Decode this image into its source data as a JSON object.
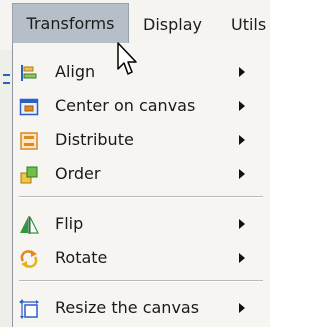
{
  "menubar": {
    "items": [
      {
        "label": "Transforms"
      },
      {
        "label": "Display"
      },
      {
        "label": "Utils"
      }
    ]
  },
  "menu": {
    "items": [
      {
        "label": "Align",
        "icon": "align-icon",
        "submenu": true
      },
      {
        "label": "Center on canvas",
        "icon": "center-on-canvas-icon",
        "submenu": true
      },
      {
        "label": "Distribute",
        "icon": "distribute-icon",
        "submenu": true
      },
      {
        "label": "Order",
        "icon": "order-icon",
        "submenu": true
      },
      {
        "label": "Flip",
        "icon": "flip-icon",
        "submenu": true
      },
      {
        "label": "Rotate",
        "icon": "rotate-icon",
        "submenu": true
      },
      {
        "label": "Resize the canvas",
        "icon": "resize-canvas-icon",
        "submenu": true
      }
    ]
  },
  "colors": {
    "active_menu_bg": "#b6bec8",
    "menu_bg": "#f6f5f2",
    "icon_blue": "#2b5fc6",
    "icon_orange": "#e08a1e",
    "icon_green": "#2c9a3a"
  }
}
